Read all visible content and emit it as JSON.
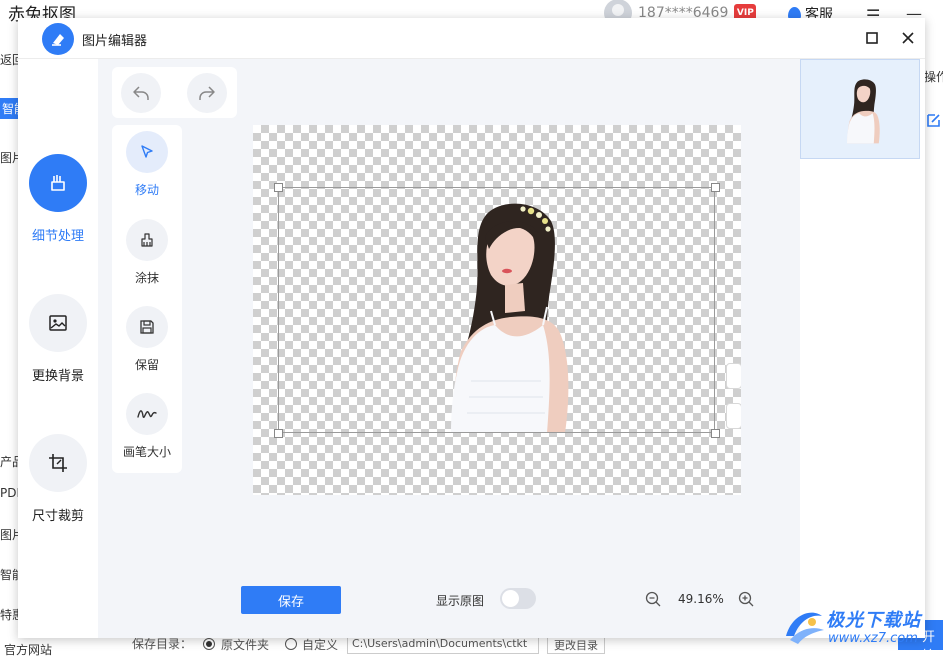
{
  "background_app": {
    "title": "赤兔抠图",
    "user": "187****6469",
    "vip_badge": "VIP",
    "service": "客服",
    "menu_icon": "menu-icon",
    "minimize_icon": "minimize-icon",
    "left_items": [
      "返回",
      "智能",
      "图片",
      "产品",
      "PDF",
      "图片",
      "智能",
      "特惠"
    ],
    "site": "官方网站",
    "right_items": [
      "操作"
    ],
    "save_dir_label": "保存目录：",
    "radio_original": "原文件夹",
    "radio_custom": "自定义",
    "path": "C:\\Users\\admin\\Documents\\ctkt",
    "change_dir": "更改目录",
    "start_button": "开始"
  },
  "modal": {
    "title": "图片编辑器",
    "maximize_icon": "maximize-icon",
    "close_icon": "close-icon",
    "tools": [
      {
        "label": "细节处理",
        "icon": "eraser-icon",
        "active": true
      },
      {
        "label": "更换背景",
        "icon": "image-icon",
        "active": false
      },
      {
        "label": "尺寸裁剪",
        "icon": "crop-icon",
        "active": false
      }
    ],
    "brush_tools": [
      {
        "label": "移动",
        "icon": "cursor-icon",
        "active": true
      },
      {
        "label": "涂抹",
        "icon": "brush-icon",
        "active": false
      },
      {
        "label": "保留",
        "icon": "save-disk-icon",
        "active": false
      },
      {
        "label": "画笔大小",
        "icon": "squiggle-icon",
        "active": false
      }
    ],
    "undo_icon": "undo-icon",
    "redo_icon": "redo-icon",
    "save_button": "保存",
    "show_original_label": "显示原图",
    "show_original_on": false,
    "zoom": "49.16%",
    "zoom_out_icon": "zoom-out-icon",
    "zoom_in_icon": "zoom-in-icon"
  },
  "watermark": {
    "text": "极光下载站",
    "url": "www.xz7.com"
  },
  "colors": {
    "accent": "#2f7cf6",
    "edit_bg": "#f3f5f9",
    "thumb_bg": "#e6f0fc"
  }
}
